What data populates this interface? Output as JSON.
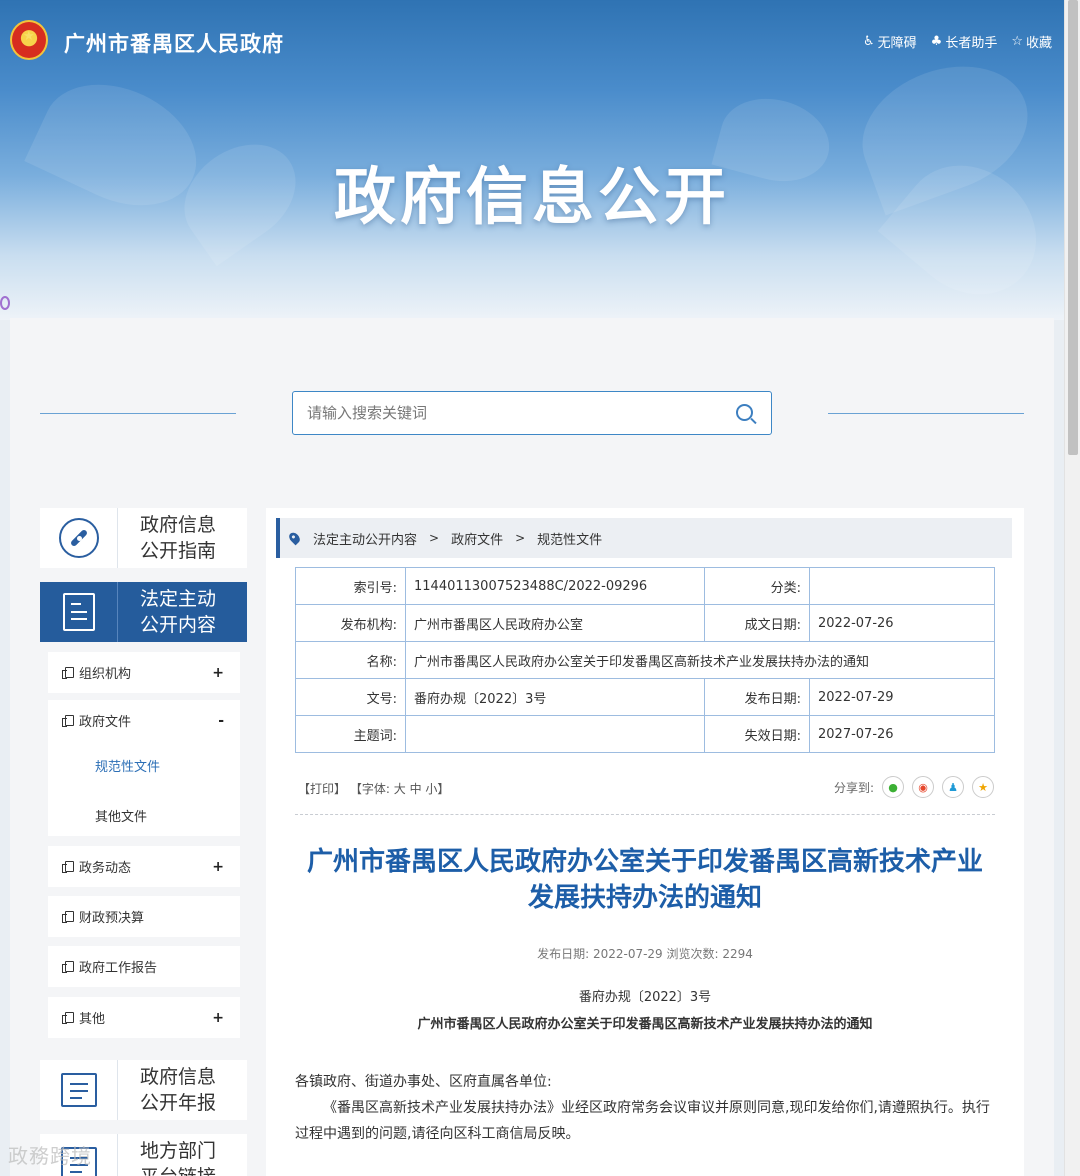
{
  "header": {
    "site_name": "广州市番禺区人民政府",
    "links": [
      {
        "icon": "wheelchair-icon",
        "label": "无障碍"
      },
      {
        "icon": "elder-icon",
        "label": "长者助手"
      },
      {
        "icon": "star-icon",
        "label": "收藏"
      }
    ],
    "banner_title": "政府信息公开"
  },
  "search": {
    "placeholder": "请输入搜索关键词"
  },
  "sidebar": {
    "guide": {
      "line1": "政府信息",
      "line2": "公开指南"
    },
    "active": {
      "line1": "法定主动",
      "line2": "公开内容"
    },
    "items": [
      {
        "label": "组织机构",
        "toggle": "+"
      },
      {
        "label": "政府文件",
        "toggle": "-"
      },
      {
        "label": "政务动态",
        "toggle": "+"
      },
      {
        "label": "财政预决算",
        "toggle": ""
      },
      {
        "label": "政府工作报告",
        "toggle": ""
      },
      {
        "label": "其他",
        "toggle": "+"
      }
    ],
    "children": [
      "规范性文件",
      "其他文件"
    ],
    "annual": {
      "line1": "政府信息",
      "line2": "公开年报"
    },
    "local": {
      "line1": "地方部门",
      "line2": "平台链接"
    }
  },
  "breadcrumb": [
    "法定主动公开内容",
    "政府文件",
    "规范性文件"
  ],
  "meta": {
    "index_label": "索引号:",
    "index_value": "11440113007523488C/2022-09296",
    "category_label": "分类:",
    "category_value": "",
    "org_label": "发布机构:",
    "org_value": "广州市番禺区人民政府办公室",
    "created_label": "成文日期:",
    "created_value": "2022-07-26",
    "name_label": "名称:",
    "name_value": "广州市番禺区人民政府办公室关于印发番禺区高新技术产业发展扶持办法的通知",
    "docno_label": "文号:",
    "docno_value": "番府办规〔2022〕3号",
    "published_label": "发布日期:",
    "published_value": "2022-07-29",
    "subject_label": "主题词:",
    "subject_value": "",
    "expire_label": "失效日期:",
    "expire_value": "2027-07-26"
  },
  "tools": {
    "print": "【打印】",
    "font_prefix": "【字体:",
    "large": "大",
    "medium": "中",
    "small": "小",
    "font_suffix": "】"
  },
  "share": {
    "label": "分享到:",
    "icons": [
      "wechat-icon",
      "weibo-icon",
      "qq-icon",
      "qzone-icon"
    ]
  },
  "article": {
    "title": "广州市番禺区人民政府办公室关于印发番禺区高新技术产业发展扶持办法的通知",
    "pub_info": "发布日期: 2022-07-29  浏览次数: 2294",
    "doc_no": "番府办规〔2022〕3号",
    "subtitle": "广州市番禺区人民政府办公室关于印发番禺区高新技术产业发展扶持办法的通知",
    "salutation": "各镇政府、街道办事处、区府直属各单位:",
    "paragraph": "《番禺区高新技术产业发展扶持办法》业经区政府常务会议审议并原则同意,现印发给你们,请遵照执行。执行过程中遇到的问题,请径向区科工商信局反映。"
  },
  "watermark": "政務跨境"
}
